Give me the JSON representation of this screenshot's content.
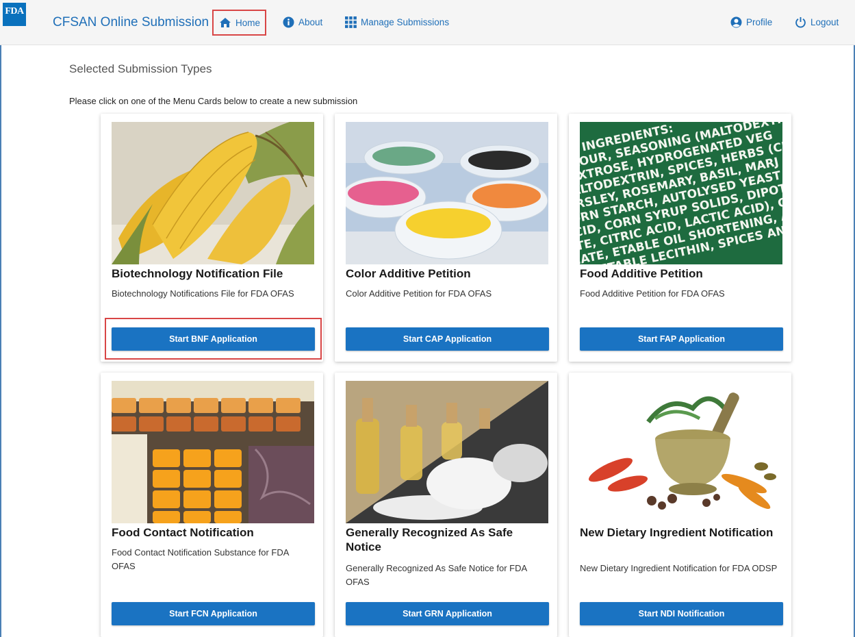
{
  "header": {
    "logo_text": "FDA",
    "app_title": "CFSAN Online Submission",
    "nav": {
      "home": "Home",
      "about": "About",
      "manage": "Manage Submissions",
      "profile": "Profile",
      "logout": "Logout"
    }
  },
  "main": {
    "heading": "Selected Submission Types",
    "instructions": "Please click on one of the Menu Cards below to create a new submission"
  },
  "cards": [
    {
      "title": "Biotechnology Notification File",
      "description": "Biotechnology Notifications File for FDA OFAS",
      "button": "Start BNF Application",
      "image": "corn-cobs"
    },
    {
      "title": "Color Additive Petition",
      "description": "Color Additive Petition for FDA OFAS",
      "button": "Start CAP Application",
      "image": "colored-powder-bowls"
    },
    {
      "title": "Food Additive Petition",
      "description": "Food Additive Petition for FDA OFAS",
      "button": "Start FAP Application",
      "image": "ingredient-label",
      "image_text": [
        "INGREDIENTS:",
        "FLOUR, SEASONING (MALTODEXTRIN",
        "DEXTROSE, HYDROGENATED VEG",
        "MALTODEXTRIN, SPICES, HERBS (CHI",
        "PARSLEY, ROSEMARY, BASIL, MARJ",
        "CORN STARCH, AUTOLYSED YEAST E",
        "ACID, CORN SYRUP SOLIDS, DIPOT",
        "ATE, CITRIC ACID, LACTIC ACID), C",
        "HATE, ETABLE OIL SHORTENING, ASCOR",
        "VEGETABLE LECITHIN, SPICES AND"
      ]
    },
    {
      "title": "Food Contact Notification",
      "description": "Food Contact Notification Substance for FDA OFAS",
      "button": "Start FCN Application",
      "image": "cheese-stacks"
    },
    {
      "title": "Generally Recognized As Safe Notice",
      "description": "Generally Recognized As Safe Notice for FDA OFAS",
      "button": "Start GRN Application",
      "image": "oil-bottles-powder"
    },
    {
      "title": "New Dietary Ingredient Notification",
      "description": "New Dietary Ingredient Notification for FDA ODSP",
      "button": "Start NDI Notification",
      "image": "mortar-herbs-spices"
    }
  ],
  "colors": {
    "brand": "#0a71bd",
    "button": "#1a73c2",
    "highlight": "#d84545"
  }
}
